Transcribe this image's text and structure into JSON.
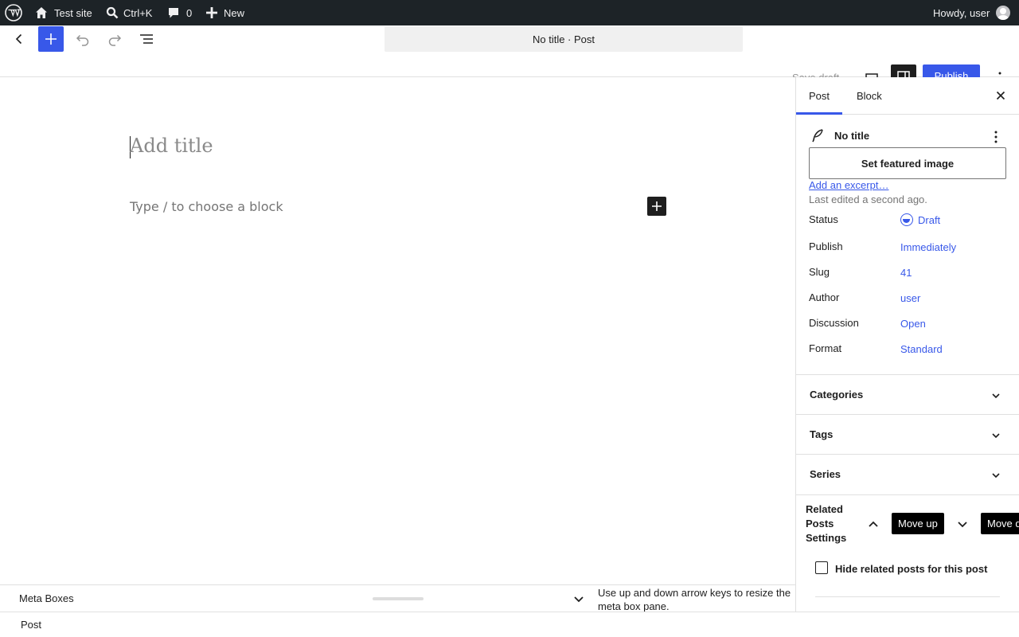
{
  "adminbar": {
    "site_name": "Test site",
    "search_shortcut": "Ctrl+K",
    "comments_count": "0",
    "new_label": "New",
    "greeting": "Howdy, user"
  },
  "header": {
    "document_title": "No title · Post",
    "save_draft_label": "Save draft",
    "publish_label": "Publish"
  },
  "canvas": {
    "title_placeholder": "Add title",
    "block_placeholder": "Type / to choose a block"
  },
  "metaboxes": {
    "label": "Meta Boxes",
    "help_text": "Use up and down arrow keys to resize the meta box pane."
  },
  "footer": {
    "breadcrumb": "Post"
  },
  "sidebar": {
    "tabs": [
      {
        "label": "Post"
      },
      {
        "label": "Block"
      }
    ],
    "post_title": "No title",
    "featured_image_label": "Set featured image",
    "excerpt_link": "Add an excerpt…",
    "last_edited": "Last edited a second ago.",
    "rows": [
      {
        "label": "Status",
        "value": "Draft"
      },
      {
        "label": "Publish",
        "value": "Immediately"
      },
      {
        "label": "Slug",
        "value": "41"
      },
      {
        "label": "Author",
        "value": "user"
      },
      {
        "label": "Discussion",
        "value": "Open"
      },
      {
        "label": "Format",
        "value": "Standard"
      }
    ],
    "panels": [
      {
        "title": "Categories"
      },
      {
        "title": "Tags"
      },
      {
        "title": "Series"
      }
    ],
    "related_posts": {
      "title": "Related Posts Settings",
      "move_up_tooltip": "Move up",
      "move_down_tooltip": "Move down",
      "checkbox_label": "Hide related posts for this post"
    }
  },
  "colors": {
    "accent": "#3858e9",
    "adminbar_bg": "#1d2327"
  }
}
